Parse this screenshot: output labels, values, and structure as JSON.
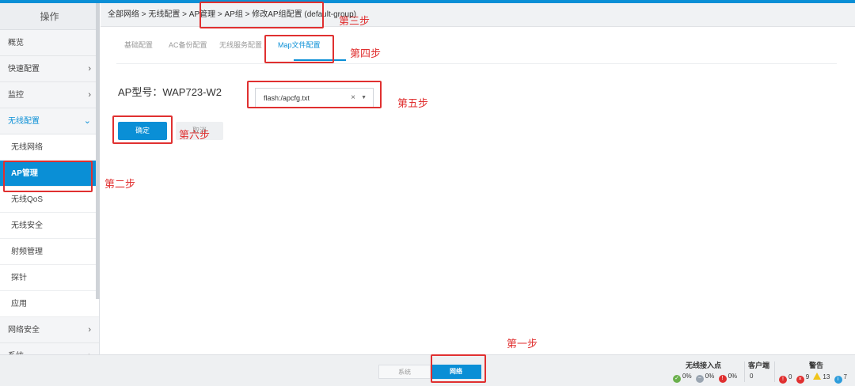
{
  "sidebar": {
    "header": "操作",
    "items_top": [
      {
        "label": "概览",
        "chevron": ""
      },
      {
        "label": "快速配置",
        "chevron": "›"
      },
      {
        "label": "监控",
        "chevron": "›"
      },
      {
        "label": "无线配置",
        "chevron": "⌄"
      }
    ],
    "sub_items": [
      "无线网络",
      "AP管理",
      "无线QoS",
      "无线安全",
      "射频管理",
      "探针",
      "应用"
    ],
    "items_bottom": [
      {
        "label": "网络安全",
        "chevron": "›"
      },
      {
        "label": "系统",
        "chevron": "›"
      }
    ]
  },
  "breadcrumb": "全部网络 > 无线配置 > AP管理 > AP组 > 修改AP组配置 (default-group)",
  "tabs": [
    "基础配置",
    "AC备份配置",
    "无线服务配置",
    "Map文件配置"
  ],
  "form": {
    "ap_model_label": "AP型号：WAP723-W2",
    "map_file_value": "flash:/apcfg.txt",
    "clear_symbol": "×",
    "caret_symbol": "▼",
    "ok_button": "确定",
    "cancel_button": "取消"
  },
  "bottombar": {
    "system_tab": "系统",
    "network_tab": "网络",
    "wireless_ap_title": "无线接入点",
    "wireless_ap_values": [
      "0%",
      "0%",
      "0%"
    ],
    "clients_title": "客户端",
    "clients_value": "0",
    "alerts_title": "警告",
    "alerts_values": [
      "0",
      "9",
      "13",
      "7"
    ]
  },
  "annotations": [
    "第一步",
    "第二步",
    "第三步",
    "第四步",
    "第五步",
    "第六步"
  ],
  "colors": {
    "accent": "#0a8fd6",
    "annotation": "#e03030",
    "ok_green": "#6ab04c",
    "warn_yellow": "#f0c419",
    "error_red": "#e03030",
    "info_blue": "#2d9cdb"
  }
}
